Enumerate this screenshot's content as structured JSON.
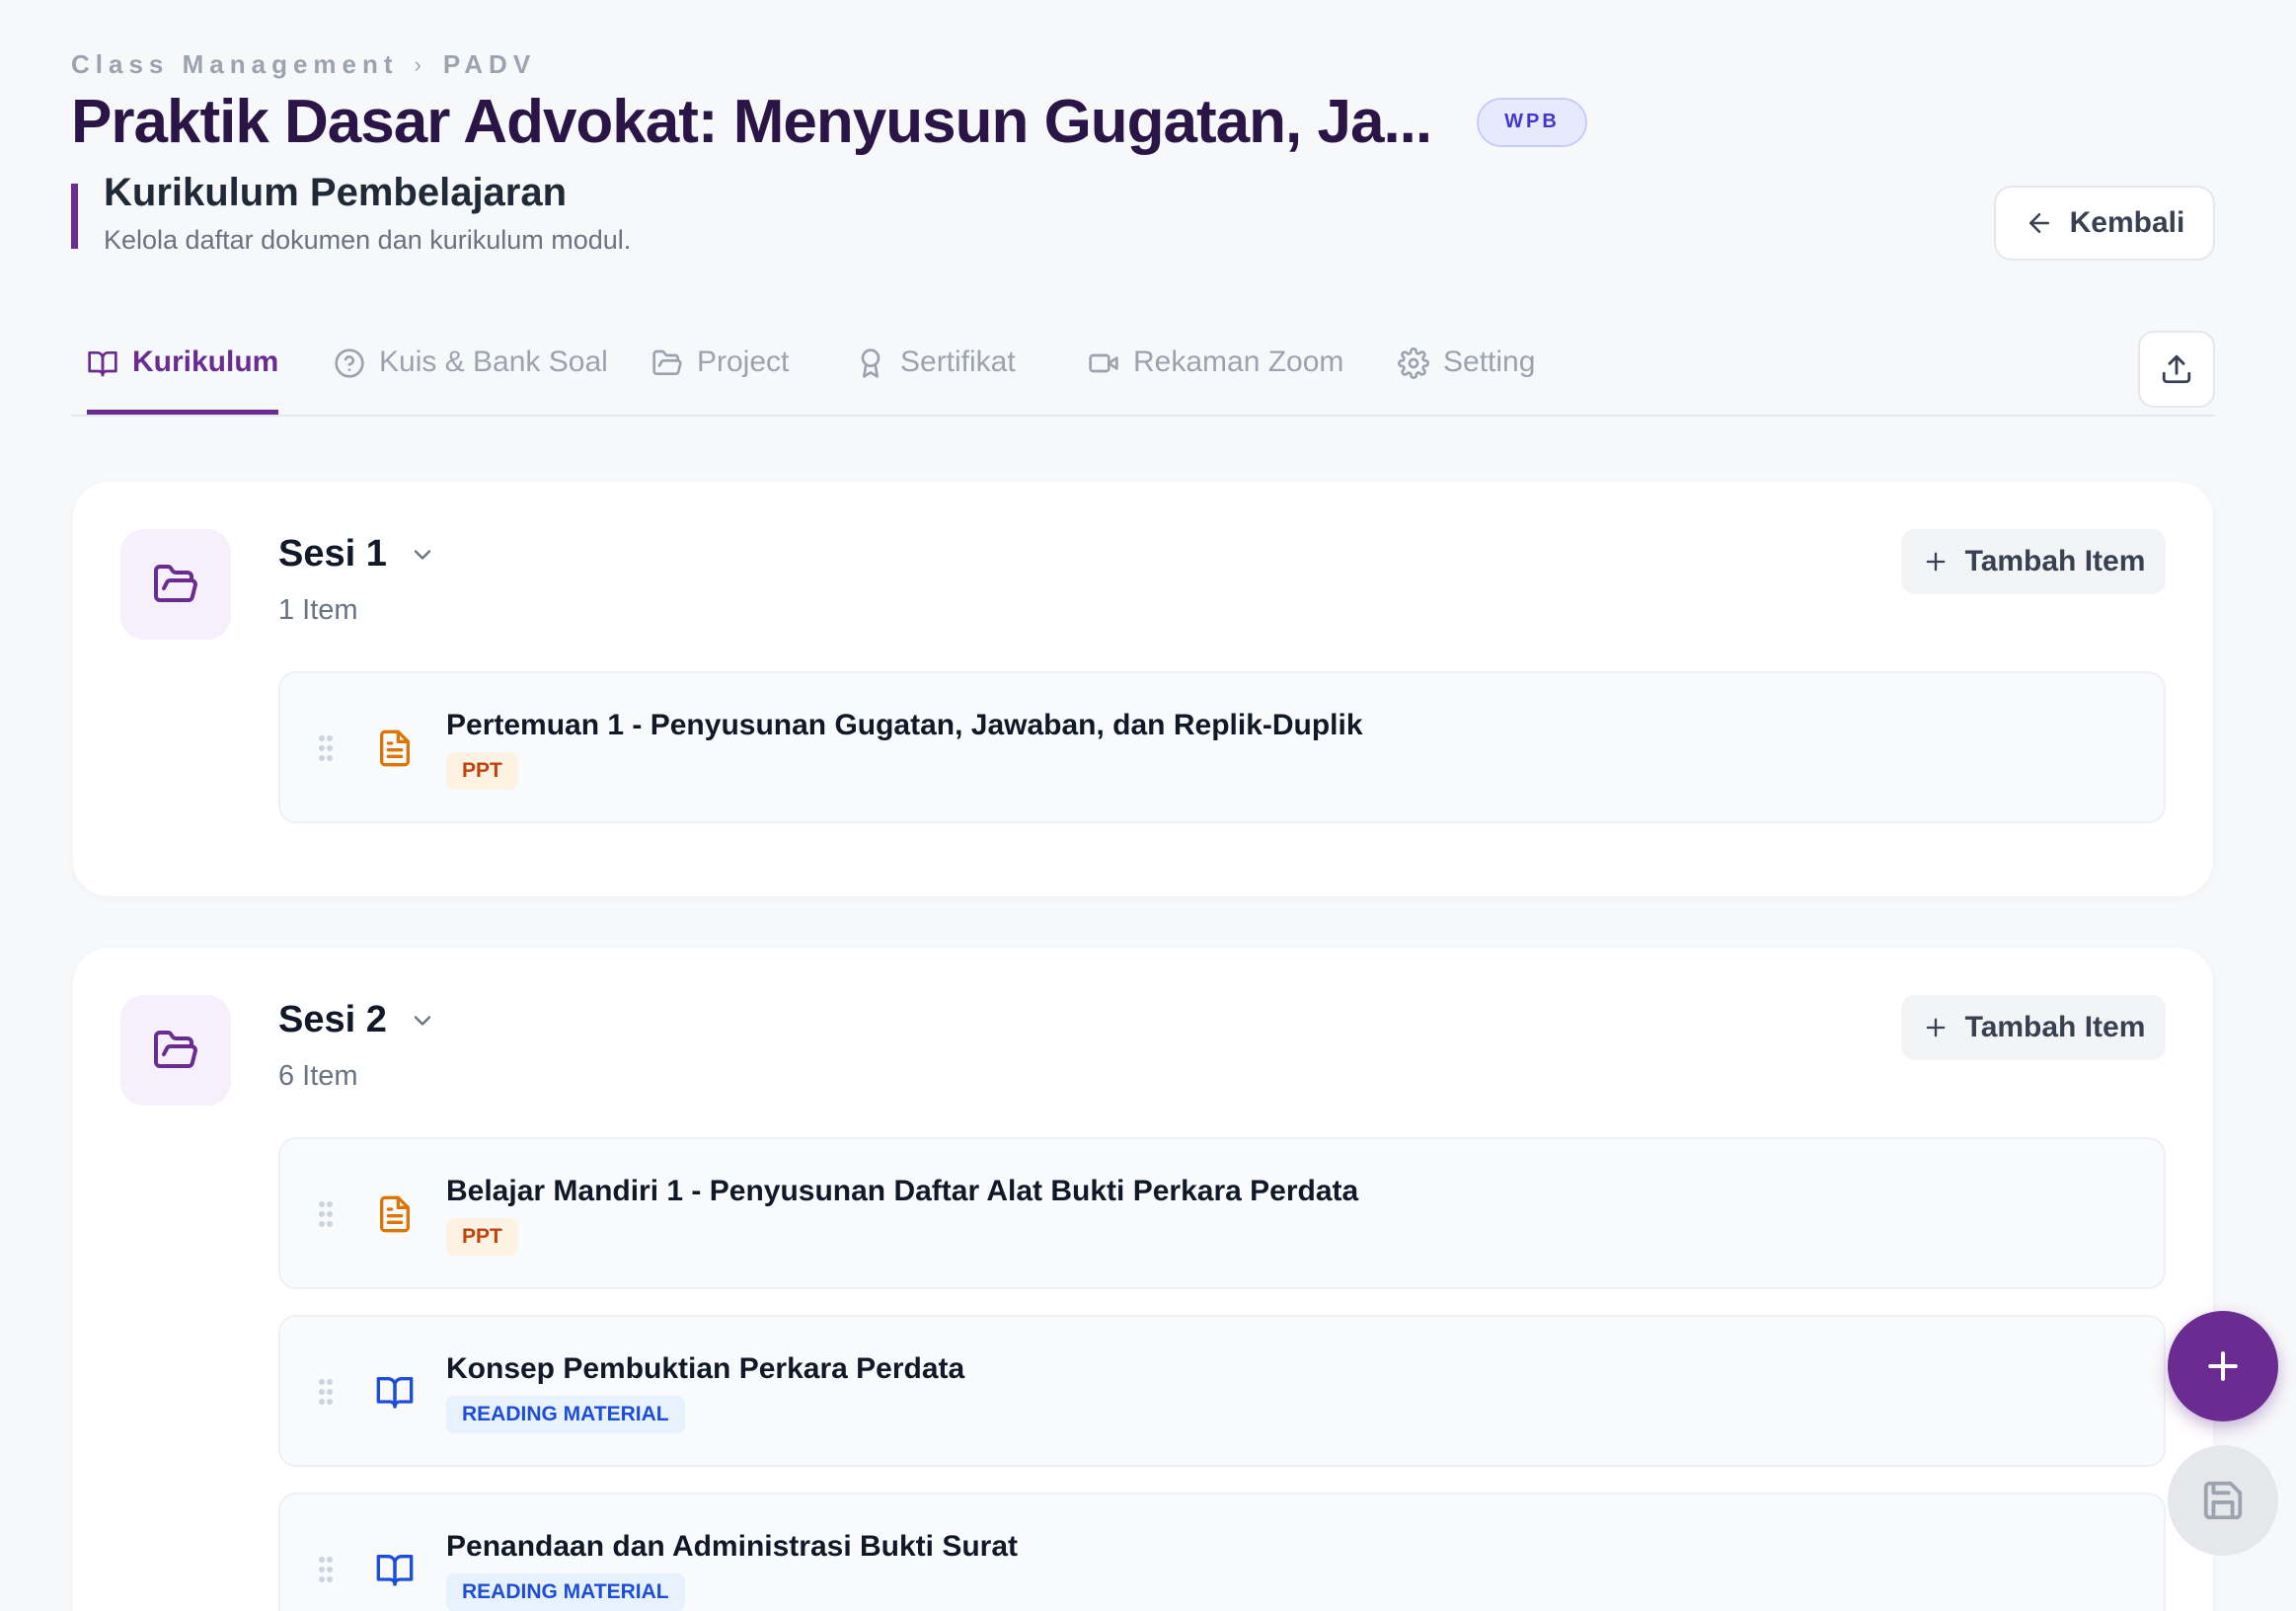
{
  "breadcrumb": {
    "root": "Class Management",
    "current": "PADV",
    "separator": "›"
  },
  "header": {
    "title": "Praktik Dasar Advokat: Menyusun Gugatan, Ja...",
    "badge": "WPB"
  },
  "section": {
    "title": "Kurikulum Pembelajaran",
    "subtitle": "Kelola daftar dokumen dan kurikulum modul."
  },
  "back_button": {
    "label": "Kembali",
    "icon": "arrow-left-icon"
  },
  "tabs": [
    {
      "label": "Kurikulum",
      "icon": "book-open-icon",
      "active": true
    },
    {
      "label": "Kuis & Bank Soal",
      "icon": "help-circle-icon",
      "active": false
    },
    {
      "label": "Project",
      "icon": "folder-icon",
      "active": false
    },
    {
      "label": "Sertifikat",
      "icon": "award-icon",
      "active": false
    },
    {
      "label": "Rekaman Zoom",
      "icon": "video-icon",
      "active": false
    },
    {
      "label": "Setting",
      "icon": "gear-icon",
      "active": false
    }
  ],
  "sessions": [
    {
      "title": "Sesi 1",
      "count": "1 Item",
      "add_label": "Tambah Item",
      "items": [
        {
          "title": "Pertemuan 1 - Penyusunan Gugatan, Jawaban, dan Replik-Duplik",
          "type": "PPT",
          "icon": "document-icon"
        }
      ]
    },
    {
      "title": "Sesi 2",
      "count": "6 Item",
      "add_label": "Tambah Item",
      "items": [
        {
          "title": "Belajar Mandiri 1 - Penyusunan Daftar Alat Bukti Perkara Perdata",
          "type": "PPT",
          "icon": "document-icon"
        },
        {
          "title": "Konsep Pembuktian Perkara Perdata",
          "type": "READING MATERIAL",
          "icon": "book-open-icon"
        },
        {
          "title": "Penandaan dan Administrasi Bukti Surat",
          "type": "READING MATERIAL",
          "icon": "book-open-icon"
        }
      ]
    }
  ],
  "colors": {
    "accent": "#6b2c91",
    "title": "#2b1446",
    "ppt": "#d97706",
    "reading": "#1d4ed8"
  }
}
